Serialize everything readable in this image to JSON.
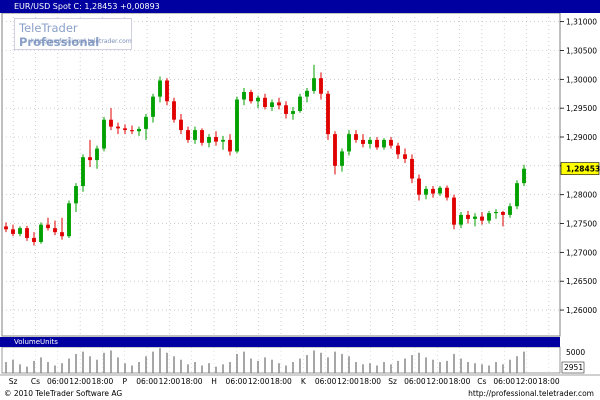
{
  "header": {
    "text": "EUR/USD Spot C: 1,28453 +0,00893"
  },
  "logo": {
    "brand_plain": "TeleTrader ",
    "brand_bold": "Professional",
    "url": "http://professional.teletrader.com"
  },
  "volume_panel": {
    "label": "Volume",
    "units_label": "Units",
    "tick_top": "5000",
    "tick_bottom": "2951"
  },
  "footer": {
    "copyright": "© 2010 TeleTrader Software AG",
    "url": "http://professional.teletrader.com"
  },
  "colors": {
    "up": "#00a000",
    "down": "#e00000",
    "header_bg": "#0000a0",
    "last_price_bg": "#ffff00",
    "volume": "#808080"
  },
  "chart_data": {
    "type": "candlestick",
    "title": "EUR/USD Spot",
    "ylim": [
      1.2555,
      1.3115
    ],
    "y_ticks": [
      "1,31000",
      "1,30500",
      "1,30000",
      "1,29500",
      "1,29000",
      "1,28500",
      "1,28000",
      "1,27500",
      "1,27000",
      "1,26500",
      "1,26000"
    ],
    "y_tick_values": [
      1.31,
      1.305,
      1.3,
      1.295,
      1.29,
      1.285,
      1.28,
      1.275,
      1.27,
      1.265,
      1.26
    ],
    "last_price": 1.28453,
    "last_price_label": "1,28453",
    "change_label": "+0,00893",
    "x_ticks": [
      "Sz",
      "Cs",
      "06:00",
      "12:00",
      "18:00",
      "P",
      "06:00",
      "12:00",
      "18:00",
      "H",
      "06:00",
      "12:00",
      "18:00",
      "K",
      "06:00",
      "12:00",
      "18:00",
      "Sz",
      "06:00",
      "12:00",
      "18:00",
      "Cs",
      "06:00",
      "12:00",
      "18:00"
    ],
    "grid": true,
    "candles": [
      {
        "o": 1.2745,
        "h": 1.2752,
        "l": 1.2735,
        "c": 1.274
      },
      {
        "o": 1.274,
        "h": 1.2748,
        "l": 1.2728,
        "c": 1.2732
      },
      {
        "o": 1.2732,
        "h": 1.2745,
        "l": 1.2728,
        "c": 1.2742
      },
      {
        "o": 1.2742,
        "h": 1.2746,
        "l": 1.272,
        "c": 1.2725
      },
      {
        "o": 1.2725,
        "h": 1.2735,
        "l": 1.2712,
        "c": 1.2718
      },
      {
        "o": 1.2718,
        "h": 1.2752,
        "l": 1.2715,
        "c": 1.2748
      },
      {
        "o": 1.2748,
        "h": 1.276,
        "l": 1.2738,
        "c": 1.2742
      },
      {
        "o": 1.2742,
        "h": 1.2755,
        "l": 1.273,
        "c": 1.2735
      },
      {
        "o": 1.2735,
        "h": 1.276,
        "l": 1.2722,
        "c": 1.2728
      },
      {
        "o": 1.2728,
        "h": 1.279,
        "l": 1.2725,
        "c": 1.2785
      },
      {
        "o": 1.2785,
        "h": 1.282,
        "l": 1.277,
        "c": 1.2815
      },
      {
        "o": 1.2815,
        "h": 1.287,
        "l": 1.2805,
        "c": 1.2865
      },
      {
        "o": 1.2865,
        "h": 1.2895,
        "l": 1.2848,
        "c": 1.286
      },
      {
        "o": 1.286,
        "h": 1.2885,
        "l": 1.2845,
        "c": 1.288
      },
      {
        "o": 1.288,
        "h": 1.2935,
        "l": 1.2875,
        "c": 1.293
      },
      {
        "o": 1.293,
        "h": 1.295,
        "l": 1.2912,
        "c": 1.2918
      },
      {
        "o": 1.2918,
        "h": 1.2925,
        "l": 1.2905,
        "c": 1.2915
      },
      {
        "o": 1.2915,
        "h": 1.2922,
        "l": 1.2905,
        "c": 1.2912
      },
      {
        "o": 1.2912,
        "h": 1.292,
        "l": 1.2905,
        "c": 1.291
      },
      {
        "o": 1.291,
        "h": 1.2918,
        "l": 1.2902,
        "c": 1.2914
      },
      {
        "o": 1.2914,
        "h": 1.294,
        "l": 1.2895,
        "c": 1.2935
      },
      {
        "o": 1.2935,
        "h": 1.2975,
        "l": 1.2925,
        "c": 1.297
      },
      {
        "o": 1.297,
        "h": 1.3005,
        "l": 1.296,
        "c": 1.2998
      },
      {
        "o": 1.2998,
        "h": 1.3002,
        "l": 1.2955,
        "c": 1.2962
      },
      {
        "o": 1.2962,
        "h": 1.2968,
        "l": 1.2925,
        "c": 1.293
      },
      {
        "o": 1.293,
        "h": 1.294,
        "l": 1.2905,
        "c": 1.2912
      },
      {
        "o": 1.2912,
        "h": 1.2918,
        "l": 1.289,
        "c": 1.2895
      },
      {
        "o": 1.2895,
        "h": 1.2918,
        "l": 1.2888,
        "c": 1.2912
      },
      {
        "o": 1.2912,
        "h": 1.2915,
        "l": 1.2885,
        "c": 1.289
      },
      {
        "o": 1.289,
        "h": 1.2905,
        "l": 1.2882,
        "c": 1.29
      },
      {
        "o": 1.29,
        "h": 1.291,
        "l": 1.2885,
        "c": 1.2892
      },
      {
        "o": 1.2892,
        "h": 1.2902,
        "l": 1.2878,
        "c": 1.2895
      },
      {
        "o": 1.2895,
        "h": 1.2905,
        "l": 1.2868,
        "c": 1.2875
      },
      {
        "o": 1.2875,
        "h": 1.297,
        "l": 1.2872,
        "c": 1.2965
      },
      {
        "o": 1.2965,
        "h": 1.2985,
        "l": 1.2955,
        "c": 1.2978
      },
      {
        "o": 1.2978,
        "h": 1.2982,
        "l": 1.2958,
        "c": 1.2962
      },
      {
        "o": 1.2962,
        "h": 1.2972,
        "l": 1.295,
        "c": 1.2968
      },
      {
        "o": 1.2968,
        "h": 1.2975,
        "l": 1.2948,
        "c": 1.2952
      },
      {
        "o": 1.2952,
        "h": 1.2965,
        "l": 1.2945,
        "c": 1.296
      },
      {
        "o": 1.296,
        "h": 1.2968,
        "l": 1.2948,
        "c": 1.2955
      },
      {
        "o": 1.2955,
        "h": 1.2962,
        "l": 1.2932,
        "c": 1.294
      },
      {
        "o": 1.294,
        "h": 1.2952,
        "l": 1.293,
        "c": 1.2945
      },
      {
        "o": 1.2945,
        "h": 1.2975,
        "l": 1.2942,
        "c": 1.297
      },
      {
        "o": 1.297,
        "h": 1.2985,
        "l": 1.296,
        "c": 1.298
      },
      {
        "o": 1.298,
        "h": 1.3025,
        "l": 1.2975,
        "c": 1.3002
      },
      {
        "o": 1.3002,
        "h": 1.3012,
        "l": 1.2965,
        "c": 1.2975
      },
      {
        "o": 1.2975,
        "h": 1.298,
        "l": 1.2895,
        "c": 1.2905
      },
      {
        "o": 1.2905,
        "h": 1.291,
        "l": 1.2835,
        "c": 1.285
      },
      {
        "o": 1.285,
        "h": 1.288,
        "l": 1.284,
        "c": 1.2875
      },
      {
        "o": 1.2875,
        "h": 1.2912,
        "l": 1.2868,
        "c": 1.2905
      },
      {
        "o": 1.2905,
        "h": 1.2912,
        "l": 1.289,
        "c": 1.2895
      },
      {
        "o": 1.2895,
        "h": 1.2905,
        "l": 1.2882,
        "c": 1.2888
      },
      {
        "o": 1.2888,
        "h": 1.29,
        "l": 1.288,
        "c": 1.2895
      },
      {
        "o": 1.2895,
        "h": 1.29,
        "l": 1.2878,
        "c": 1.2882
      },
      {
        "o": 1.2882,
        "h": 1.2898,
        "l": 1.2878,
        "c": 1.2895
      },
      {
        "o": 1.2895,
        "h": 1.29,
        "l": 1.288,
        "c": 1.2885
      },
      {
        "o": 1.2885,
        "h": 1.289,
        "l": 1.2862,
        "c": 1.287
      },
      {
        "o": 1.287,
        "h": 1.288,
        "l": 1.2855,
        "c": 1.2862
      },
      {
        "o": 1.2862,
        "h": 1.287,
        "l": 1.282,
        "c": 1.2828
      },
      {
        "o": 1.2828,
        "h": 1.2835,
        "l": 1.279,
        "c": 1.28
      },
      {
        "o": 1.28,
        "h": 1.2815,
        "l": 1.2792,
        "c": 1.281
      },
      {
        "o": 1.281,
        "h": 1.2815,
        "l": 1.2795,
        "c": 1.2802
      },
      {
        "o": 1.2802,
        "h": 1.2815,
        "l": 1.2798,
        "c": 1.2812
      },
      {
        "o": 1.2812,
        "h": 1.2816,
        "l": 1.279,
        "c": 1.2795
      },
      {
        "o": 1.2795,
        "h": 1.28,
        "l": 1.274,
        "c": 1.2748
      },
      {
        "o": 1.2748,
        "h": 1.277,
        "l": 1.2742,
        "c": 1.2765
      },
      {
        "o": 1.2765,
        "h": 1.2772,
        "l": 1.275,
        "c": 1.2758
      },
      {
        "o": 1.2758,
        "h": 1.2768,
        "l": 1.2745,
        "c": 1.2762
      },
      {
        "o": 1.2762,
        "h": 1.277,
        "l": 1.2748,
        "c": 1.2755
      },
      {
        "o": 1.2755,
        "h": 1.2772,
        "l": 1.275,
        "c": 1.2768
      },
      {
        "o": 1.2768,
        "h": 1.2775,
        "l": 1.2758,
        "c": 1.277
      },
      {
        "o": 1.277,
        "h": 1.2772,
        "l": 1.2745,
        "c": 1.2765
      },
      {
        "o": 1.2765,
        "h": 1.2785,
        "l": 1.276,
        "c": 1.278
      },
      {
        "o": 1.278,
        "h": 1.2825,
        "l": 1.2775,
        "c": 1.282
      },
      {
        "o": 1.282,
        "h": 1.2852,
        "l": 1.2815,
        "c": 1.2845
      }
    ],
    "volumes": [
      3900,
      4100,
      3700,
      3500,
      4000,
      4300,
      3900,
      3600,
      3800,
      4200,
      4600,
      4800,
      4400,
      4100,
      4700,
      4900,
      4300,
      3800,
      3600,
      3900,
      4400,
      4800,
      5100,
      4700,
      4400,
      4100,
      3700,
      3900,
      3600,
      3800,
      3500,
      3700,
      3900,
      4600,
      4800,
      4200,
      4000,
      4300,
      4100,
      3800,
      3600,
      3900,
      4200,
      4500,
      4900,
      4700,
      4300,
      4800,
      4600,
      4400,
      3900,
      3700,
      3800,
      3600,
      3900,
      3700,
      4000,
      4200,
      4500,
      4700,
      4300,
      4100,
      3900,
      4000,
      4600,
      4200,
      3900,
      3800,
      3700,
      3600,
      3900,
      3700,
      4100,
      4400,
      4800
    ],
    "volume_ylim": [
      2951,
      5200
    ]
  }
}
